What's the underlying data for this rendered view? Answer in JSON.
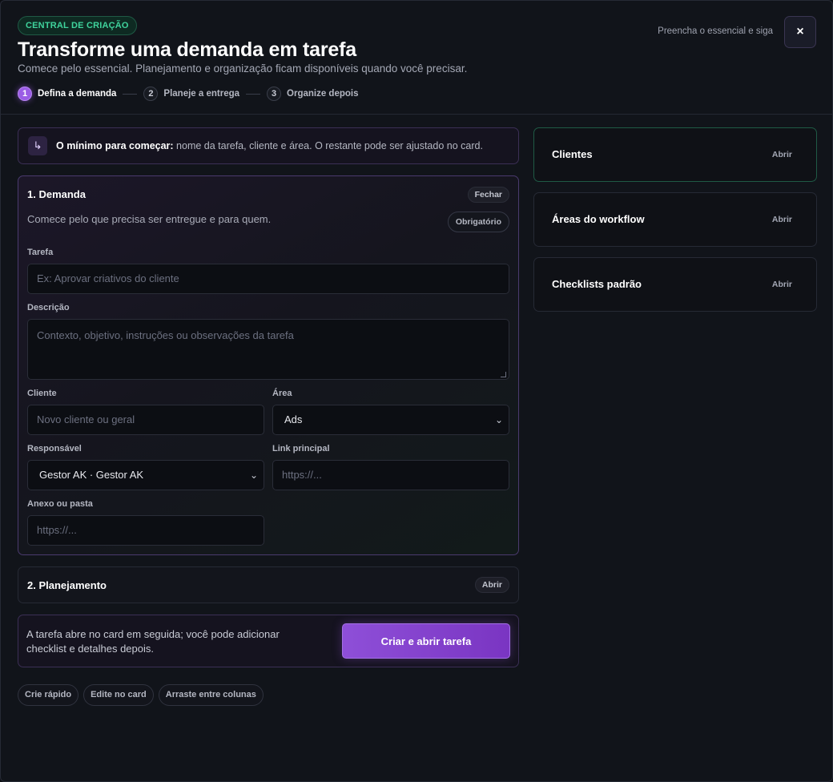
{
  "header": {
    "eyebrow": "CENTRAL DE CRIAÇÃO",
    "title": "Transforme uma demanda em tarefa",
    "subtitle": "Comece pelo essencial. Planejamento e organização ficam disponíveis quando você precisar.",
    "hint": "Preencha o essencial e siga",
    "close_icon": "×"
  },
  "steps": [
    {
      "num": "1",
      "label": "Defina a demanda"
    },
    {
      "num": "2",
      "label": "Planeje a entrega"
    },
    {
      "num": "3",
      "label": "Organize depois"
    }
  ],
  "info": {
    "icon": "↳",
    "bold": "O mínimo para começar:",
    "text": " nome da tarefa, cliente e área. O restante pode ser ajustado no card."
  },
  "demanda": {
    "title": "1. Demanda",
    "toggle": "Fechar",
    "description": "Comece pelo que precisa ser entregue e para quem.",
    "badge": "Obrigatório",
    "tarefa_label": "Tarefa",
    "tarefa_placeholder": "Ex: Aprovar criativos do cliente",
    "descricao_label": "Descrição",
    "descricao_placeholder": "Contexto, objetivo, instruções ou observações da tarefa",
    "cliente_label": "Cliente",
    "cliente_placeholder": "Novo cliente ou geral",
    "area_label": "Área",
    "area_value": "Ads",
    "responsavel_label": "Responsável",
    "responsavel_value": "Gestor AK · Gestor AK",
    "link_label": "Link principal",
    "link_placeholder": "https://...",
    "anexo_label": "Anexo ou pasta",
    "anexo_placeholder": "https://..."
  },
  "planejamento": {
    "title": "2. Planejamento",
    "toggle": "Abrir"
  },
  "footer": {
    "text": "A tarefa abre no card em seguida; você pode adicionar checklist e detalhes depois.",
    "button": "Criar e abrir tarefa"
  },
  "chips": [
    "Crie rápido",
    "Edite no card",
    "Arraste entre colunas"
  ],
  "side": [
    {
      "title": "Clientes",
      "action": "Abrir"
    },
    {
      "title": "Áreas do workflow",
      "action": "Abrir"
    },
    {
      "title": "Checklists padrão",
      "action": "Abrir"
    }
  ],
  "colors": {
    "accent": "#9b5de5",
    "success": "#3fd39c",
    "background": "#11141a"
  }
}
